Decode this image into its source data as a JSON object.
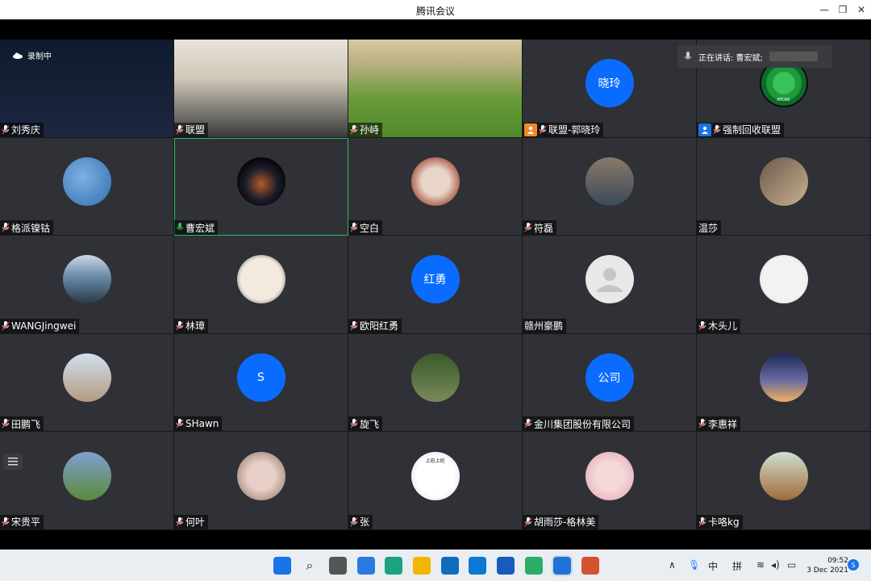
{
  "window": {
    "title": "腾讯会议",
    "minimize": "—",
    "restore": "❐",
    "close": "✕"
  },
  "recording": {
    "label": "录制中"
  },
  "speaking": {
    "label": "正在讲话: 曹宏斌;"
  },
  "participants": [
    {
      "name": "刘秀庆",
      "avatar": "",
      "kind": "night-sky"
    },
    {
      "name": "联盟",
      "avatar": "",
      "kind": "office"
    },
    {
      "name": "孙峙",
      "avatar": "",
      "kind": "landscape"
    },
    {
      "name": "联盟-郭晓玲",
      "avatar": "晓玲",
      "kind": "text",
      "badge": "orange"
    },
    {
      "name": "强制回收联盟",
      "avatar": "",
      "kind": "logo",
      "badge": "blue",
      "logo_text": "ATCRR"
    },
    {
      "name": "格派镍钴",
      "avatar": "",
      "kind": "wind"
    },
    {
      "name": "曹宏斌",
      "avatar": "",
      "kind": "wing",
      "active": true
    },
    {
      "name": "空白",
      "avatar": "",
      "kind": "person-mask"
    },
    {
      "name": "符磊",
      "avatar": "",
      "kind": "person-chair"
    },
    {
      "name": "温莎",
      "avatar": "",
      "kind": "room",
      "no_mic": true
    },
    {
      "name": "WANGJingwei",
      "avatar": "",
      "kind": "lake"
    },
    {
      "name": "林璋",
      "avatar": "",
      "kind": "art"
    },
    {
      "name": "欧阳红勇",
      "avatar": "红勇",
      "kind": "text"
    },
    {
      "name": "赣州豪鹏",
      "avatar": "",
      "kind": "default",
      "no_mic": true
    },
    {
      "name": "木头儿",
      "avatar": "",
      "kind": "cartoon"
    },
    {
      "name": "田鹏飞",
      "avatar": "",
      "kind": "couple"
    },
    {
      "name": "SHawn",
      "avatar": "S",
      "kind": "text"
    },
    {
      "name": "旋飞",
      "avatar": "",
      "kind": "man-tree"
    },
    {
      "name": "金川集团股份有限公司",
      "avatar": "公司",
      "kind": "text"
    },
    {
      "name": "李惠祥",
      "avatar": "",
      "kind": "sunset"
    },
    {
      "name": "宋贵平",
      "avatar": "",
      "kind": "garden"
    },
    {
      "name": "何叶",
      "avatar": "",
      "kind": "baby"
    },
    {
      "name": "张",
      "avatar": "",
      "kind": "meme",
      "meme_text": "上班上班"
    },
    {
      "name": "胡雨莎-格林美",
      "avatar": "",
      "kind": "girl"
    },
    {
      "name": "卡咯kg",
      "avatar": "",
      "kind": "squirrel"
    }
  ],
  "taskbar": {
    "tray_ime1": "中",
    "tray_ime2": "拼",
    "time": "09:52",
    "date": "3 Dec 2021"
  },
  "colors": {
    "accent": "#0a6cff",
    "active_border": "#2dbb5d",
    "tile_bg": "#2f3136"
  }
}
